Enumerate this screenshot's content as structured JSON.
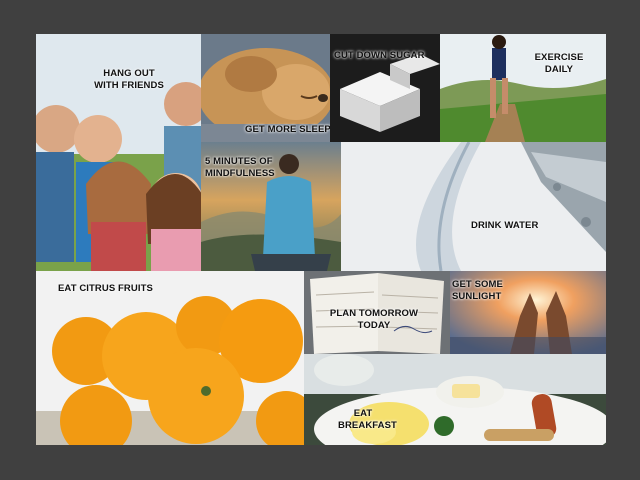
{
  "background": "#404040",
  "tiles": [
    {
      "id": "friends",
      "label": "HANG OUT\nWITH FRIENDS"
    },
    {
      "id": "sleep",
      "label": "GET MORE SLEEP"
    },
    {
      "id": "sugar",
      "label": "CUT DOWN SUGAR"
    },
    {
      "id": "exercise",
      "label": "EXERCISE\nDAILY"
    },
    {
      "id": "mindfulness",
      "label": "5 MINUTES OF\nMINDFULNESS"
    },
    {
      "id": "water",
      "label": "DRINK WATER"
    },
    {
      "id": "citrus",
      "label": "EAT CITRUS FRUITS"
    },
    {
      "id": "plan",
      "label": "PLAN TOMORROW\nTODAY"
    },
    {
      "id": "sunlight",
      "label": "GET SOME\nSUNLIGHT"
    },
    {
      "id": "breakfast",
      "label": "EAT\nBREAKFAST"
    }
  ]
}
